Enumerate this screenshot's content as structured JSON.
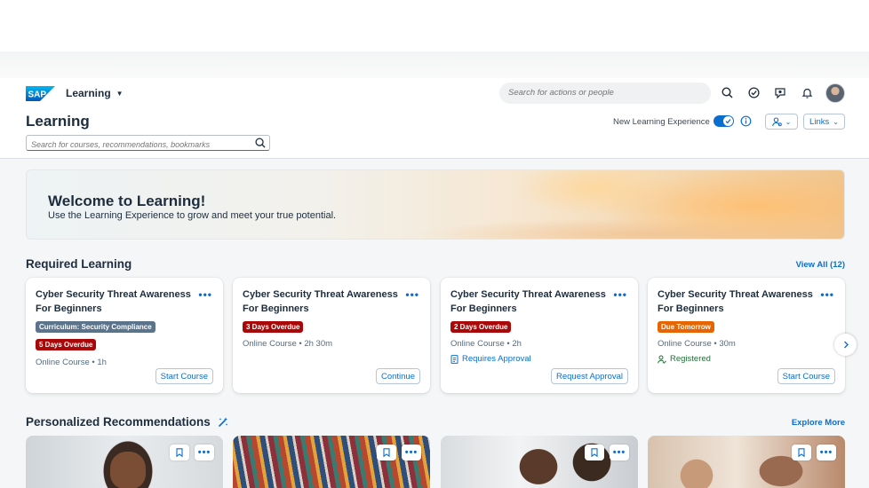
{
  "shell": {
    "app_title": "Learning",
    "search_placeholder": "Search for actions or people"
  },
  "header": {
    "page_title": "Learning",
    "course_search_placeholder": "Search for courses, recommendations, bookmarks",
    "new_experience_label": "New Learning Experience",
    "new_experience_on": true,
    "links_label": "Links"
  },
  "banner": {
    "title": "Welcome to Learning!",
    "subtitle": "Use the Learning Experience to grow and meet your true potential."
  },
  "required": {
    "title": "Required Learning",
    "view_all": "View All (12)",
    "cards": [
      {
        "title": "Cyber Security Threat Awareness For Beginners",
        "tags": [
          "Curriculum: Security Compliance",
          "5 Days Overdue"
        ],
        "meta": "Online Course • 1h",
        "status": "",
        "action": "Start Course"
      },
      {
        "title": "Cyber Security Threat Awareness For Beginners",
        "tags": [
          "3 Days Overdue"
        ],
        "meta": "Online Course • 2h 30m",
        "status": "",
        "action": "Continue"
      },
      {
        "title": "Cyber Security Threat Awareness For Beginners",
        "tags": [
          "2 Days Overdue"
        ],
        "meta": "Online Course • 2h",
        "status": "Requires Approval",
        "action": "Request Approval"
      },
      {
        "title": "Cyber Security Threat Awareness For Beginners",
        "tags": [
          "Due Tomorrow"
        ],
        "meta": "Online Course • 30m",
        "status": "Registered",
        "action": "Start Course"
      }
    ]
  },
  "recommendations": {
    "title": "Personalized Recommendations",
    "explore": "Explore More"
  },
  "colors": {
    "accent": "#0a6ed1",
    "overdue": "#aa0808",
    "due_soon": "#e76500",
    "tag_grey": "#5b738b",
    "registered": "#256f3a"
  }
}
